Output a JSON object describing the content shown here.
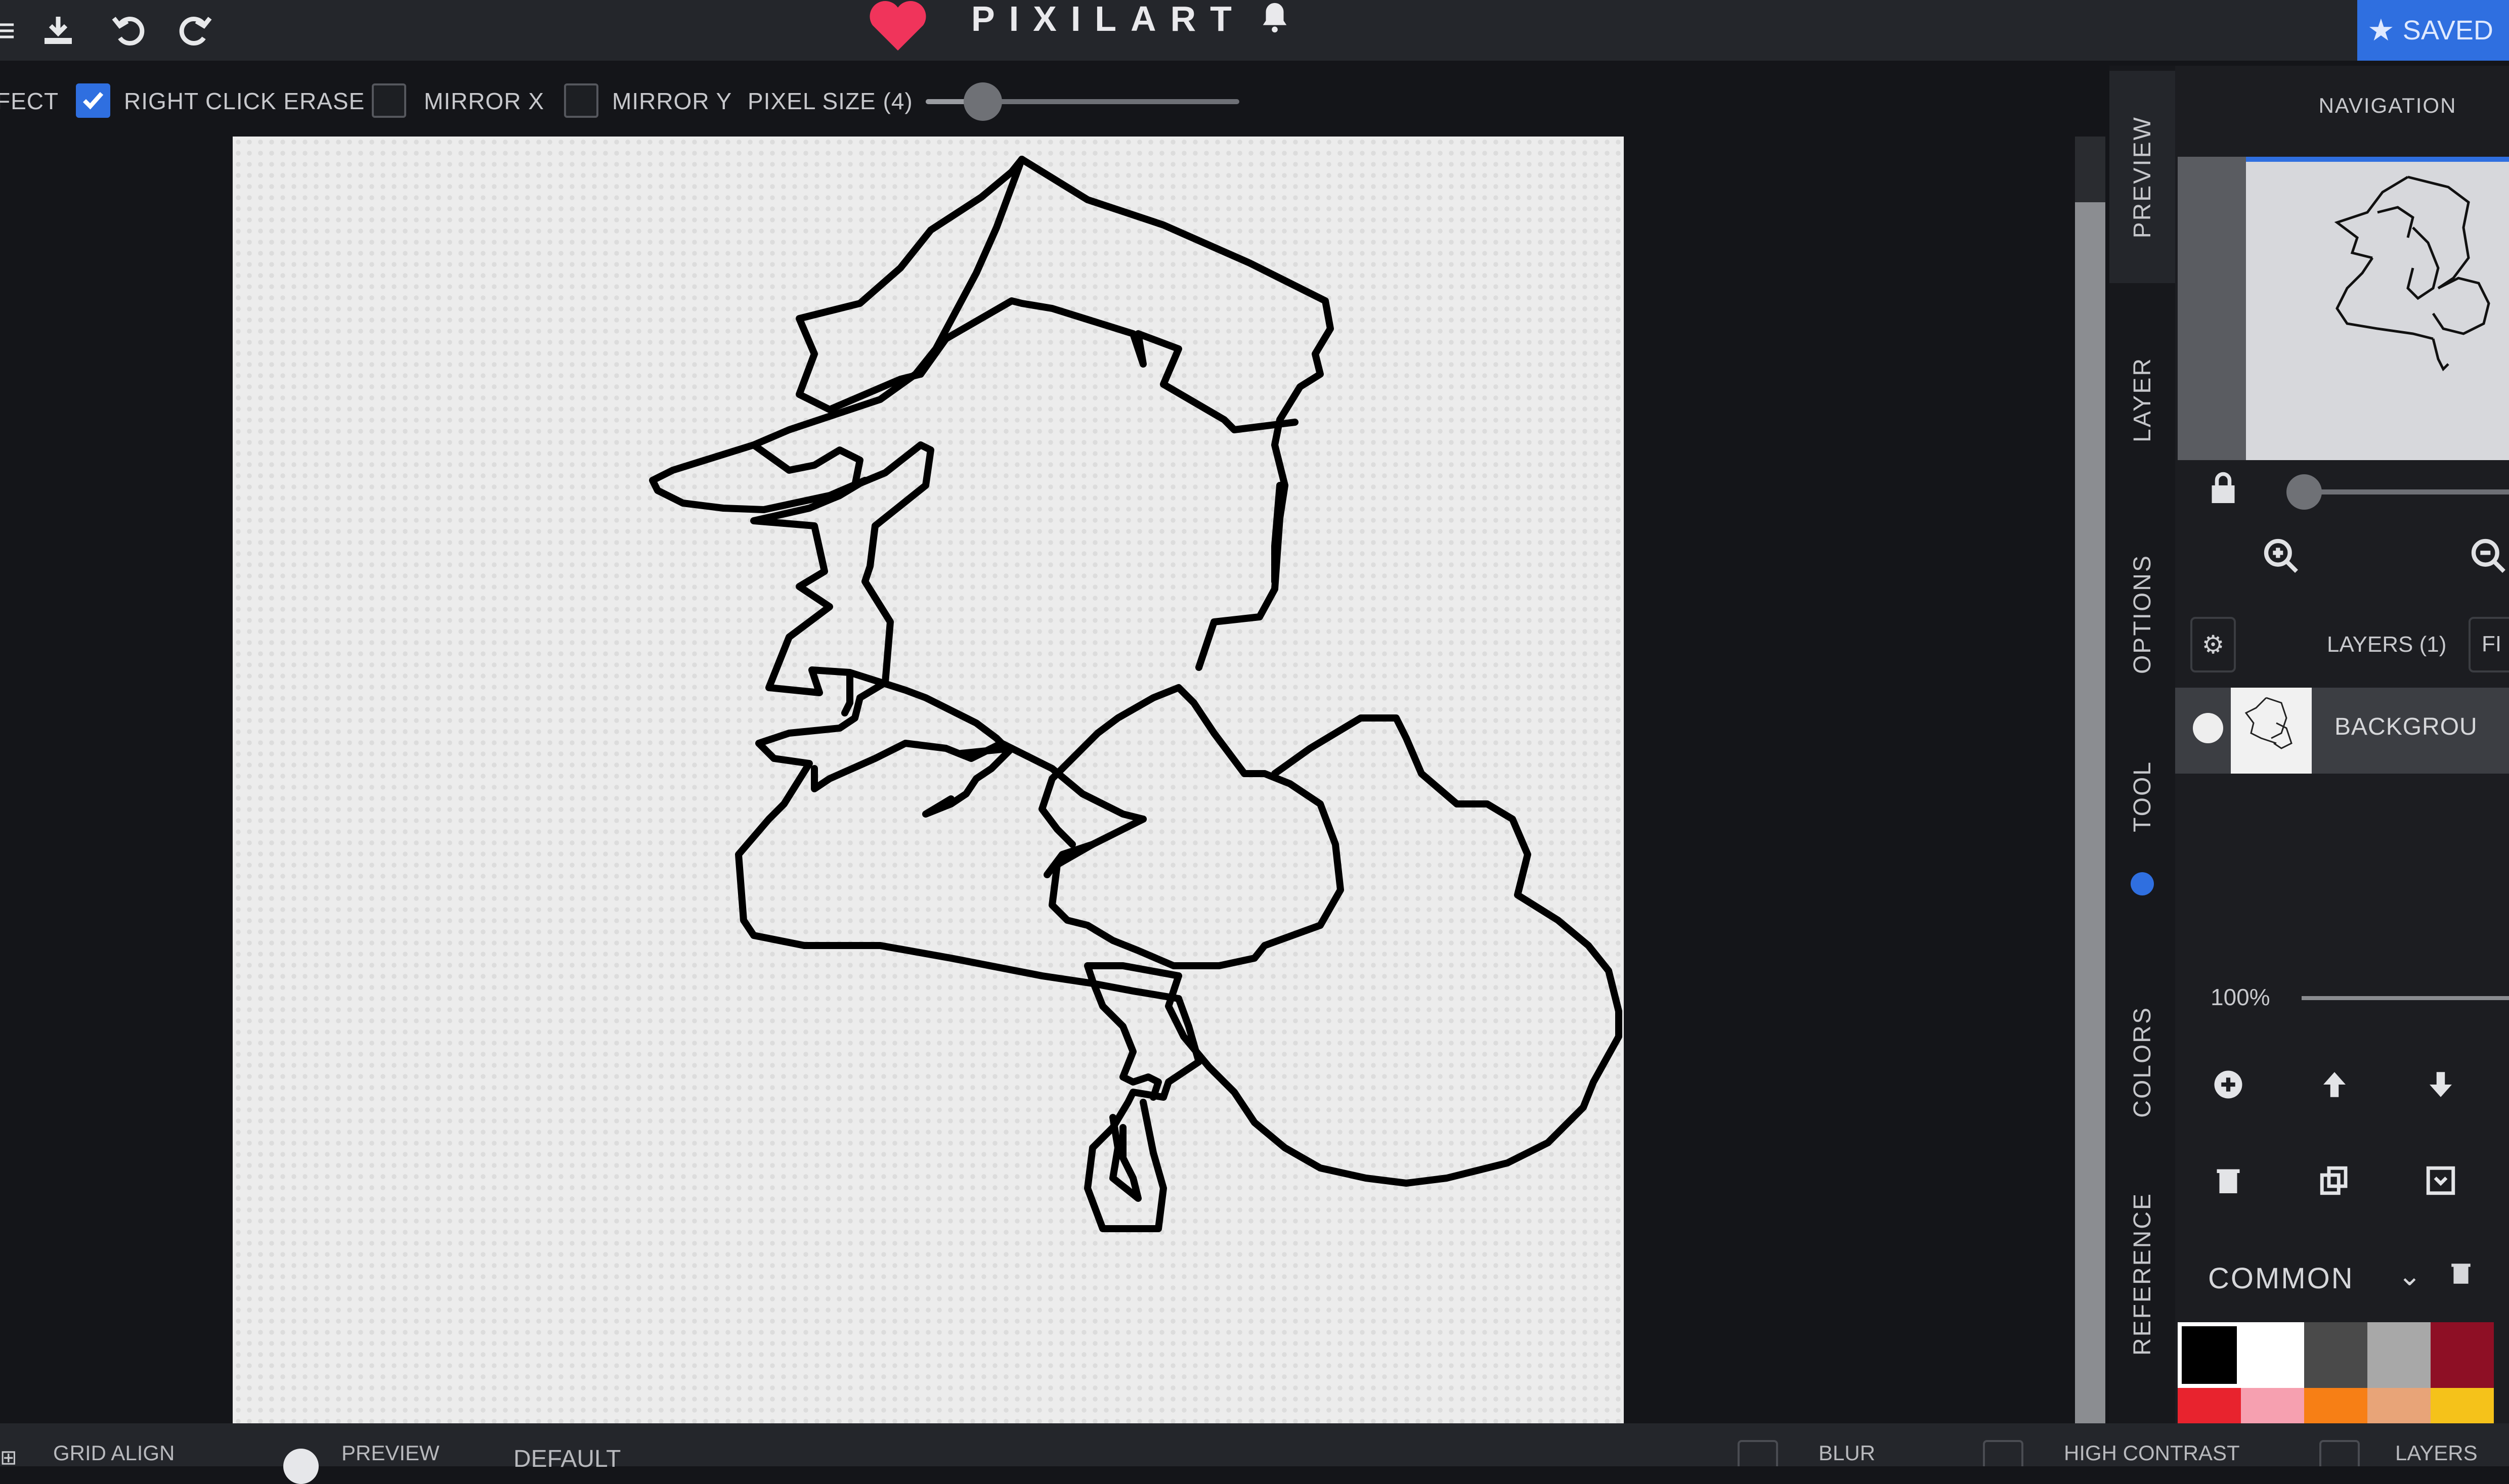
{
  "app": {
    "logo_text": "PIXILART",
    "saved_label": "SAVED",
    "top_icons": [
      "menu-icon",
      "download-icon",
      "undo-icon",
      "redo-icon"
    ]
  },
  "toolbar": {
    "effect_label": "FECT",
    "right_click_erase_label": "RIGHT CLICK ERASE",
    "right_click_erase_checked": true,
    "mirror_x_label": "MIRROR X",
    "mirror_x_checked": false,
    "mirror_y_label": "MIRROR Y",
    "mirror_y_checked": false,
    "pixel_size_label": "PIXEL SIZE (4)",
    "pixel_size_value": 4
  },
  "side_tabs": [
    "PREVIEW",
    "LAYER",
    "OPTIONS",
    "TOOL",
    "COLORS",
    "REFERENCE"
  ],
  "navigation": {
    "title": "NAVIGATION"
  },
  "layers": {
    "header_label": "LAYERS (1)",
    "filter_label": "FI",
    "items": [
      {
        "name": "BACKGROU"
      }
    ],
    "opacity_label": "100%",
    "opacity_value": 100
  },
  "palette": {
    "name": "COMMON",
    "colors": [
      "#000000",
      "#ffffff",
      "#4a4a4a",
      "#a8a8a8",
      "#8e0f25",
      "#e8232e",
      "#f6a0b0",
      "#f77f15",
      "#e8a478",
      "#f5c21a"
    ]
  },
  "bottom_bar": {
    "items": [
      "GRID ALIGN",
      "PREVIEW",
      "DEFAULT"
    ],
    "right_items": [
      "BLUR",
      "HIGH CONTRAST",
      "LAYERS"
    ]
  }
}
